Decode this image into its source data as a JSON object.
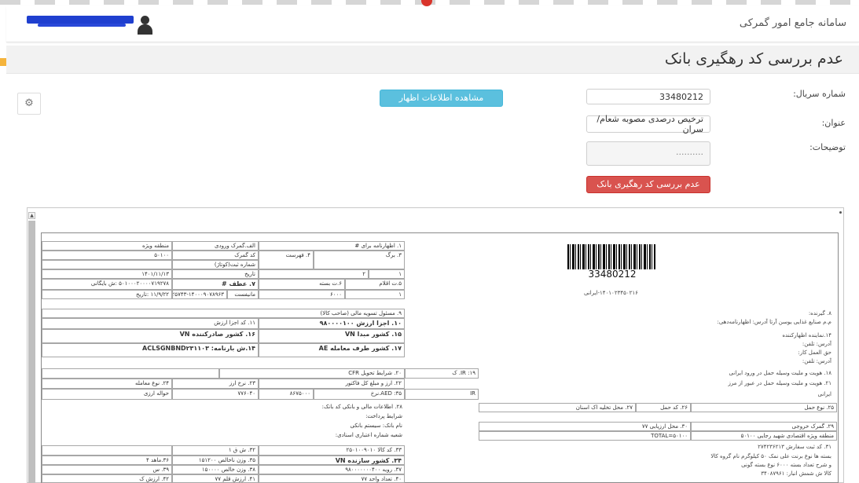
{
  "app": {
    "title": "سامانه جامع امور گمرکی",
    "page_title": "عدم بررسی کد رهگیری بانک"
  },
  "form": {
    "serial_label": "شماره سریال:",
    "serial_value": "33480212",
    "subject_label": "عنوان:",
    "subject_value": "ترخیص درصدی مصوبه شعام/ سران",
    "description_label": "توضیحات:",
    "description_placeholder": "..........",
    "view_button": "مشاهده اطلاعات اظهار",
    "submit_button": "عدم بررسی کد رهگیری بانک"
  },
  "icons": {
    "settings": "gear-icon",
    "user": "user-icon",
    "scroll_up": "chevron-up-icon"
  },
  "colors": {
    "accent_blue": "#5bc0de",
    "danger": "#d9534f",
    "orange": "#f5b43c"
  },
  "doc": {
    "barcode_number": "33480212",
    "barcode_sub": "۱۴۰۱۰۲۳۴۵۰۲۱۶-ایرانی",
    "cells": {
      "r1_a": "منطقه ویژه",
      "r1_b": "الف.گمرک ورودی",
      "r1_c": "۱. اظهارنامه برای #",
      "r2_a": "۵۰۱۰۰",
      "r2_b": "کد گمرک",
      "r2_c": "۳. برگ",
      "r2_d": "۴. فهرست",
      "r3_b": "شماره ثبت(کوتاژ)",
      "r3_d": "۲",
      "r3_e": "۱",
      "r4_a": "۱۴۰۱/۱۱/۱۳",
      "r4_b": "تاریخ",
      "r5_a": "۵۰۱۰۰۰۲۰۰۰۰۷۱۹۲۷۸ :ش بایگانی",
      "r5_b": "۷. عطف #",
      "r5_c": "۶.ت بسته",
      "r5_d": "۵.ت اقلام",
      "r6_a": "۱۱/۹/۲۲ :تاریخ",
      "r6_b": "۲۵۷۴۳-۱۴۰۰۰۹۰۷۸۹۶۳",
      "r6_c": "مانیفست",
      "r6_d": "۶۰۰۰",
      "r6_e": "۱",
      "r7_a": "۹. مسئول تسویه مالی (صاحب کالا)",
      "r8_a": "۱۱. کد اجزا ارزش",
      "r8_b": "۱۰. اجزا ارزش ۹۸۰۰۰۰۱۰۰",
      "r9_a": "۱۶. کشور صادرکننده VN",
      "r9_b": "۱۵. کشور مبدا VN",
      "r10_a": "۱۴.ش بارنامه: ACLSGNBND۲۳۱۱۰۳",
      "r10_b": "۱۷. کشور طرف معامله AE",
      "r11_a": "۲۰. شرایط تحویل CFR",
      "r11_b": "IR :۱۹. ک",
      "r12_a": "۲۴. نوع معامله",
      "r12_b": "۲۳. نرخ ارز",
      "r12_c": "۲۲. ارز و مبلغ کل فاکتور",
      "r13_a": "حواله ارزی",
      "r13_b": "۷۷۶۰۴۰",
      "r13_c": "۸۶۷۵۰۰۰",
      "r13_d": "AED :۳۵.نرخ",
      "r13_e": "IR",
      "r14_a": "۲۸. اطلاعات مالی و بانکی کد بانک:",
      "r14_b": "شرایط پرداخت:",
      "r14_c": "نام بانک: سیستم بانکی",
      "r14_d": "شعبه شماره اعتباری اسنادی:",
      "r15_a": "۲۷. محل تخلیه اک اسنان",
      "r15_b": "۲۶. کد حمل",
      "r15_c": "۲۵. نوع حمل",
      "r16_a": "۳۰. محل ارزیابی ۷۷",
      "r16_b": "۲۹. گمرک خروجی",
      "r17_a": "TOTAL=۵۰۱۰۰",
      "r17_b": "منطقه ویژه اقتصادی شهید رجایی ۵۰۱۰۰",
      "r18_a": "۳۲. ش ق ۱",
      "r18_b": "۳۳. کد کالا ۲۵۰۱۰۰۹۰۱۰",
      "r19_a": "۳۶.ماهد ۴",
      "r19_b": "۳۵. وزن ناخالص ۱۵۱۲۰۰",
      "r19_c": "۳۴. کشور سازنده VN",
      "r20_a": "۳۹. س",
      "r20_b": "۳۸. وزن خالص ۱۵۰۰۰۰",
      "r20_c": "۳۷. رویه ۹۸۰۰۰۰۰۰۰۴۰۰",
      "r21_a": "۴۲. ارزش ک",
      "r21_b": "۴۱. ارزش قلم ۷۷",
      "r21_c": "۴۰. تعداد واحد ۷۷"
    },
    "right_lines": [
      "۸. گیرنده:",
      "م.م صنایع غذایی یوسن آرتا آدرس: اظهارنامه‌دهی:",
      "۱۴.نماینده اظهارکننده",
      "آدرس: تلفن:",
      "حق العمل کار:",
      "آدرس: تلفن:",
      "۱۸. هویت و ملیت وسیله حمل در ورود ایرانی",
      "۲۱. هویت و ملیت وسیله حمل در عبور از مرز",
      "ایرانی",
      "۳۱. کد ثبت سفارش ۲۷۴۲۳۶۲۱۳",
      "بسته ها  نوع برنت علی  نمک ۵۰ کیلوگرم نام گروه کالا",
      "و شرح  تعداد بسته ۶۰۰۰  نوع بسته گونی",
      "کالا  ش شمش انبار: ۳۴۰۸۷۹۶۱"
    ]
  }
}
